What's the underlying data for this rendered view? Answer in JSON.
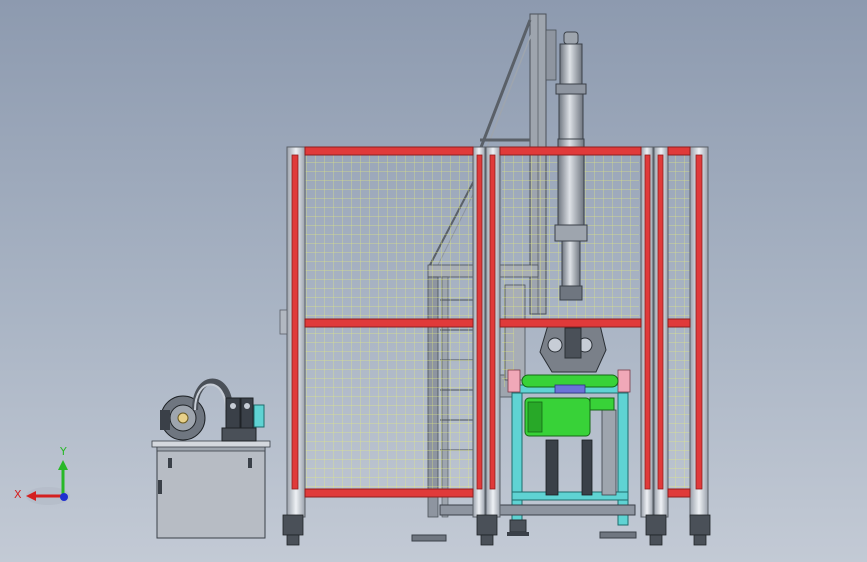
{
  "viewport": {
    "background_top": "#8d9aaf",
    "background_bottom": "#c3cad5"
  },
  "colors": {
    "frame_red": "#e03a3a",
    "frame_red_dark": "#8e1d1d",
    "aluminum": "#c7cdd6",
    "mesh_yellow": "#e6ec7a",
    "steel_gray": "#8e95a0",
    "dark_steel": "#4a5058",
    "cyan_stand": "#5fd3d3",
    "green_motor": "#38d238",
    "hyd_tank": "#b7bcc4",
    "pink_cap": "#f0a8b8"
  },
  "triad": {
    "x_label": "X",
    "y_label": "Y",
    "x_color": "#d42020",
    "y_color": "#28b828",
    "z_color": "#2030d0"
  }
}
